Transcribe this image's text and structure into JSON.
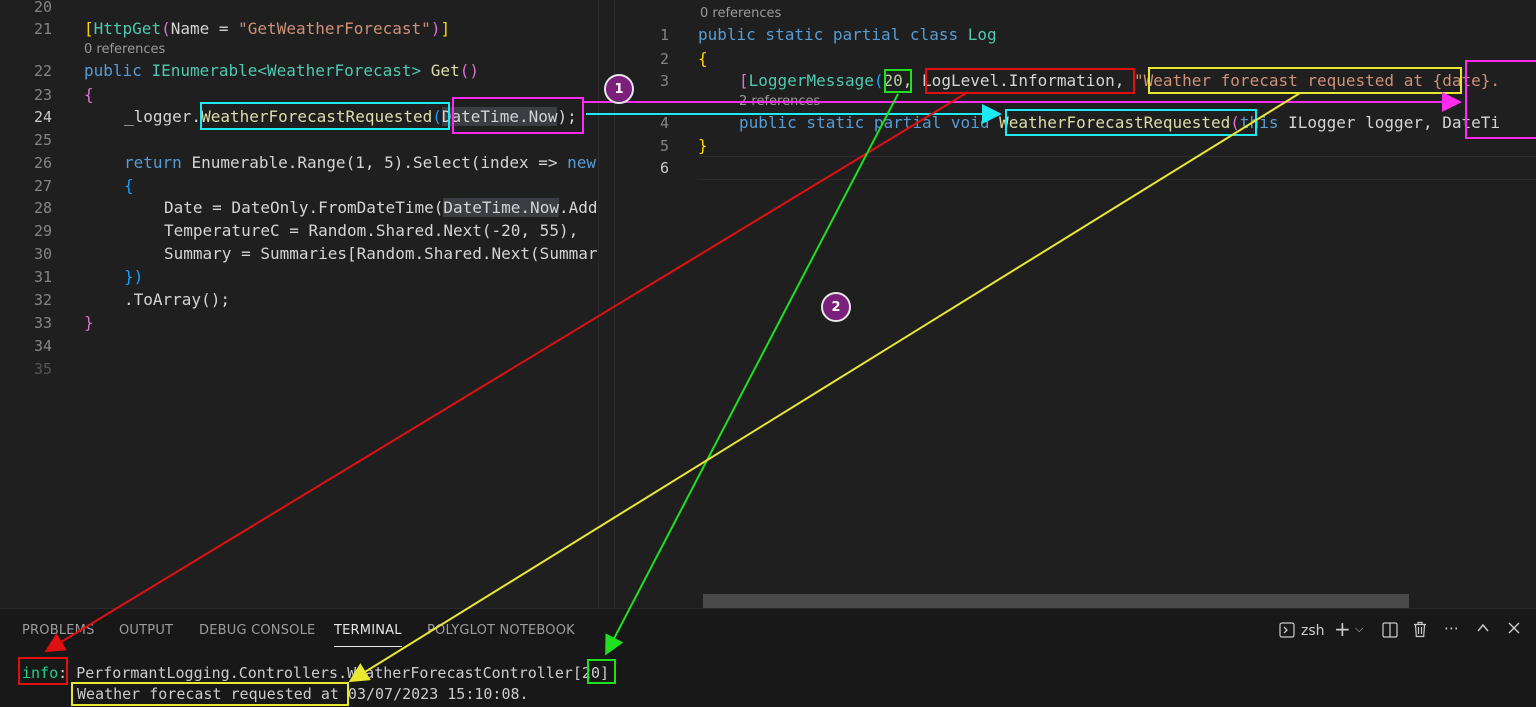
{
  "left_editor": {
    "line_numbers": [
      "20",
      "21",
      "22",
      "23",
      "24",
      "25",
      "26",
      "27",
      "28",
      "29",
      "30",
      "31",
      "32",
      "33",
      "34",
      "35"
    ],
    "lens_line21": "0 references",
    "lines": {
      "l21_attr": "HttpGet",
      "l21_name": "Name",
      "l21_str": "\"GetWeatherForecast\"",
      "l22_kw": "public",
      "l22_type": "IEnumerable<WeatherForecast>",
      "l22_fn": "Get",
      "l24_logger": "_logger.",
      "l24_method": "WeatherForecastRequested",
      "l24_arg": "DateTime.Now",
      "l24_end": ");",
      "l26_kw": "return",
      "l26_code": "Enumerable.Range(1, 5).Select(index => ",
      "l26_new": "new",
      "l28_code": "Date = DateOnly.FromDateTime(",
      "l28_arg": "DateTime.Now",
      "l28_end": ".Add",
      "l29_code": "TemperatureC = Random.Shared.Next(-20, 55),",
      "l30_code": "Summary = Summaries[Random.Shared.Next(Summar",
      "l31_code": "})",
      "l32_code": ".ToArray();",
      "l33_code": "}"
    }
  },
  "right_editor": {
    "line_numbers": [
      "1",
      "2",
      "3",
      "4",
      "5",
      "6"
    ],
    "lens_line1": "0 references",
    "lens_line4": "2 references",
    "lines": {
      "l1_kw": "public static partial class",
      "l1_type": "Log",
      "l3_attr": "LoggerMessage",
      "l3_id": "20",
      "l3_level": "LogLevel.Information",
      "l3_msg": "\"Weather forecast requested at ",
      "l3_placeholder": "{date}",
      "l4_kw": "public static partial void",
      "l4_method": "WeatherForecastRequested",
      "l4_this": "this",
      "l4_params": "ILogger logger, DateTi"
    }
  },
  "panel": {
    "tabs": [
      "PROBLEMS",
      "OUTPUT",
      "DEBUG CONSOLE",
      "TERMINAL",
      "POLYGLOT NOTEBOOK"
    ],
    "active_tab": "TERMINAL",
    "shell": "zsh",
    "terminal": {
      "line1_level": "info",
      "line1_sep": ":",
      "line1_category": "PerformantLogging.Controllers.WeatherForecastController",
      "line1_event_id": "20",
      "line1_close": "]",
      "line2_msg": "Weather forecast requested at",
      "line2_value": " 03/07/2023 15:10:08."
    }
  },
  "annotations": {
    "badge_1": "1",
    "badge_2": "2",
    "colors": {
      "cyan": "#1de9f2",
      "magenta": "#ff2cf0",
      "red": "#e01010",
      "green": "#1fe01f",
      "yellow": "#e8e832"
    }
  }
}
